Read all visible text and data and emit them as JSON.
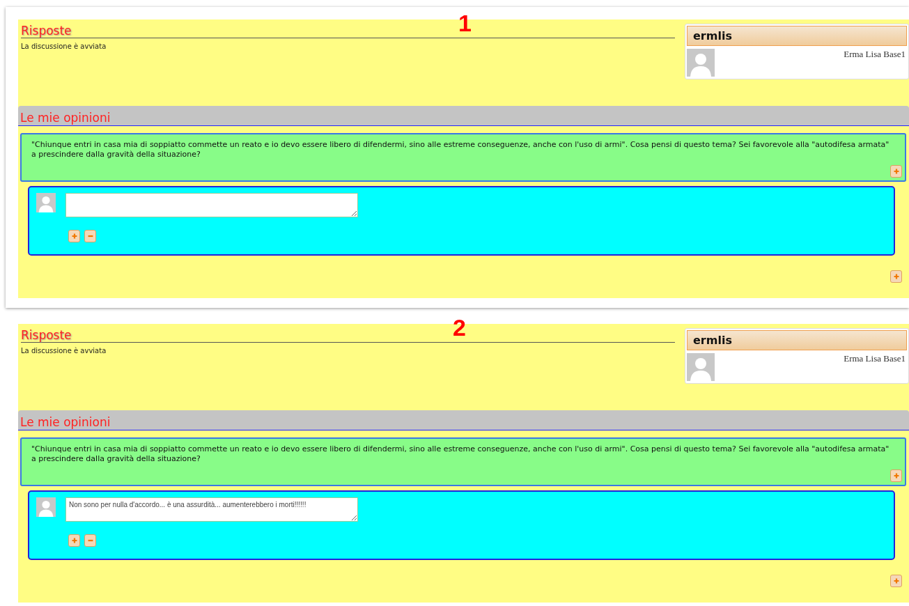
{
  "steps": [
    {
      "number": "1",
      "heading": "Risposte",
      "status": "La discussione è avviata",
      "user": {
        "username": "ermlis",
        "full_name": "Erma Lisa Base1"
      },
      "section_title": "Le mie opinioni",
      "question": "\"Chiunque entri in casa mia di soppiatto commette un reato e io devo essere libero di difendermi, sino alle estreme conseguenze, anche con l'uso di armi\". Cosa pensi di questo tema? Sei favorevole alla \"autodifesa armata\" a prescindere dalla gravità della situazione?"
    },
    {
      "number": "2",
      "heading": "Risposte",
      "status": "La discussione è avviata",
      "user": {
        "username": "ermlis",
        "full_name": "Erma Lisa Base1"
      },
      "section_title": "Le mie opinioni",
      "question": "\"Chiunque entri in casa mia di soppiatto commette un reato e io devo essere libero di difendermi, sino alle estreme conseguenze, anche con l'uso di armi\". Cosa pensi di questo tema? Sei favorevole alla \"autodifesa armata\" a prescindere dalla gravità della situazione?",
      "reply": {
        "value": "Non sono per nulla d'accordo... è una assurdità... aumenterebbero i morti!!!!!!"
      }
    }
  ]
}
